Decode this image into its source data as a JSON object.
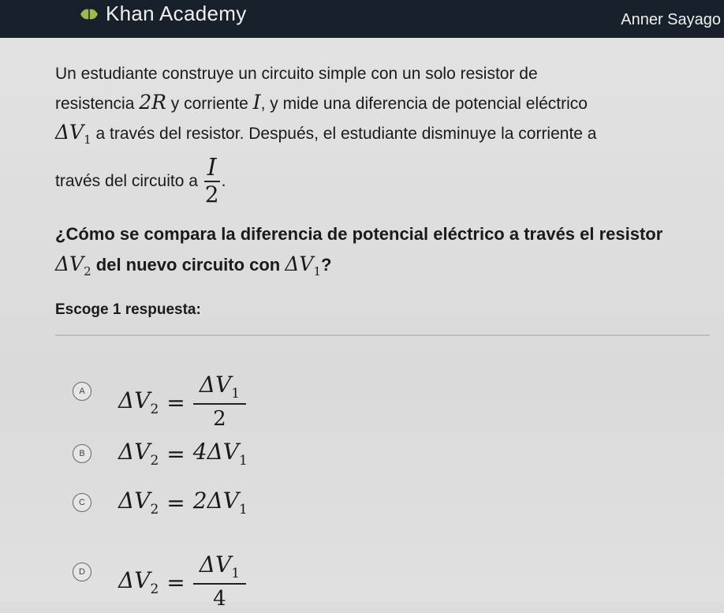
{
  "header": {
    "brand": "Khan Academy",
    "user": "Anner Sayago",
    "logo_icon": "khan-academy-leaf-icon"
  },
  "problem": {
    "p1": "Un estudiante construye un circuito simple con un solo resistor de",
    "p2a": "resistencia ",
    "r": "2R",
    "p2b": " y corriente ",
    "i": "I",
    "p2c": ", y mide una diferencia de potencial eléctrico",
    "dv1": "ΔV",
    "dv1_sub": "1",
    "p3": " a través del resistor. Después, el estudiante disminuye la corriente a",
    "p4": "través del circuito a ",
    "frac_num": "I",
    "frac_den": "2",
    "p4_end": "."
  },
  "question": {
    "q1": "¿Cómo se compara la diferencia de potencial eléctrico a través el resistor",
    "dv2": "ΔV",
    "dv2_sub": "2",
    "q2": " del nuevo circuito con ",
    "dv1": "ΔV",
    "dv1_sub": "1",
    "q_end": "?"
  },
  "prompt": "Escoge 1 respuesta:",
  "choices": [
    {
      "letter": "A",
      "lhs": "ΔV",
      "lhs_sub": "2",
      "eq": "=",
      "num": "ΔV",
      "num_sub": "1",
      "den": "2"
    },
    {
      "letter": "B",
      "lhs": "ΔV",
      "lhs_sub": "2",
      "eq": "=",
      "rhs": "4ΔV",
      "rhs_sub": "1"
    },
    {
      "letter": "C",
      "lhs": "ΔV",
      "lhs_sub": "2",
      "eq": "=",
      "rhs": "2ΔV",
      "rhs_sub": "1"
    },
    {
      "letter": "D",
      "lhs": "ΔV",
      "lhs_sub": "2",
      "eq": "=",
      "num": "ΔV",
      "num_sub": "1",
      "den": "4"
    }
  ]
}
